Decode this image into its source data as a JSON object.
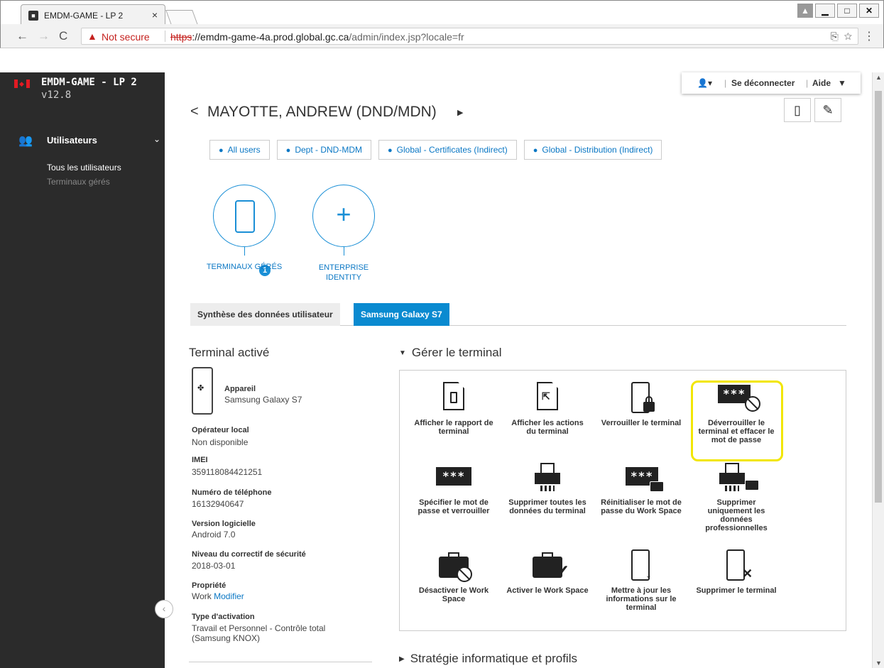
{
  "browser": {
    "tab_title": "EMDM-GAME - LP 2",
    "tab_close": "×",
    "not_secure": "Not secure",
    "url_scheme": "https",
    "url_host": "://emdm-game-4a.prod.global.gc.ca",
    "url_path": "/admin/index.jsp?locale=fr"
  },
  "sidebar": {
    "app_name": "EMDM-GAME - LP 2",
    "version": "v12.8",
    "section_label": "Utilisateurs",
    "items": [
      {
        "label": "Tous les utilisateurs"
      },
      {
        "label": "Terminaux gérés"
      }
    ]
  },
  "usermenu": {
    "logout": "Se déconnecter",
    "help": "Aide"
  },
  "header": {
    "title": "MAYOTTE, ANDREW (DND/MDN)"
  },
  "groups": [
    "All users",
    "Dept - DND-MDM",
    "Global - Certificates (Indirect)",
    "Global - Distribution (Indirect)"
  ],
  "circles": {
    "managed_label": "TERMINAUX GÉRÉS",
    "managed_count": "1",
    "identity_label_1": "ENTERPRISE",
    "identity_label_2": "IDENTITY"
  },
  "tabs": {
    "summary": "Synthèse des données utilisateur",
    "device": "Samsung Galaxy S7"
  },
  "device": {
    "panel_title": "Terminal activé",
    "fields": [
      {
        "label": "Appareil",
        "value": "Samsung Galaxy S7"
      },
      {
        "label": "Opérateur local",
        "value": "Non disponible"
      },
      {
        "label": "IMEI",
        "value": "359118084421251"
      },
      {
        "label": "Numéro de téléphone",
        "value": "16132940647"
      },
      {
        "label": "Version logicielle",
        "value": "Android 7.0"
      },
      {
        "label": "Niveau du correctif de sécurité",
        "value": "2018-03-01"
      },
      {
        "label": "Propriété",
        "value": "Work",
        "link": "Modifier"
      },
      {
        "label": "Type d'activation",
        "value": "Travail et Personnel - Contrôle total",
        "value2": "(Samsung KNOX)"
      }
    ]
  },
  "manage": {
    "title": "Gérer le terminal",
    "actions": [
      {
        "line1": "Afficher le rapport de",
        "line2": "terminal",
        "line3": "",
        "icon": "report-icon"
      },
      {
        "line1": "Afficher les actions",
        "line2": "du terminal",
        "line3": "",
        "icon": "actions-icon"
      },
      {
        "line1": "Verrouiller le terminal",
        "line2": "",
        "line3": "",
        "icon": "lock-device-icon"
      },
      {
        "line1": "Déverrouiller le",
        "line2": "terminal et effacer le",
        "line3": "mot de passe",
        "icon": "unlock-clear-password-icon"
      },
      {
        "line1": "Spécifier le mot de",
        "line2": "passe et verrouiller",
        "line3": "",
        "icon": "set-password-icon"
      },
      {
        "line1": "Supprimer toutes les",
        "line2": "données du terminal",
        "line3": "",
        "icon": "shredder-icon"
      },
      {
        "line1": "Réinitialiser le mot de",
        "line2": "passe du Work Space",
        "line3": "",
        "icon": "workspace-password-icon"
      },
      {
        "line1": "Supprimer",
        "line2": "uniquement les",
        "line3": "données",
        "line4": "professionnelles",
        "icon": "shred-work-data-icon"
      },
      {
        "line1": "Désactiver le Work",
        "line2": "Space",
        "line3": "",
        "icon": "disable-workspace-icon"
      },
      {
        "line1": "Activer le Work Space",
        "line2": "",
        "line3": "",
        "icon": "enable-workspace-icon"
      },
      {
        "line1": "Mettre à jour les",
        "line2": "informations sur le",
        "line3": "terminal",
        "icon": "update-device-icon"
      },
      {
        "line1": "Supprimer le terminal",
        "line2": "",
        "line3": "",
        "icon": "delete-device-icon"
      }
    ],
    "pwd_mask": "***"
  },
  "strategy": {
    "title": "Stratégie informatique et profils"
  },
  "colors": {
    "accent": "#0a8ad0",
    "highlight": "#f2e600",
    "sidebar_bg": "#2b2b2b",
    "warning": "#c5221f"
  }
}
